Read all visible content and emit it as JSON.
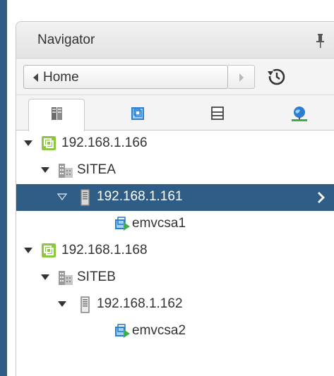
{
  "panel": {
    "title": "Navigator"
  },
  "nav": {
    "home_label": "Home"
  },
  "tabs": [
    {
      "name": "hosts-and-clusters",
      "icon": "hosts-clusters-icon",
      "active": true
    },
    {
      "name": "vms-and-templates",
      "icon": "vms-templates-icon",
      "active": false
    },
    {
      "name": "storage",
      "icon": "storage-icon",
      "active": false
    },
    {
      "name": "networking",
      "icon": "networking-icon",
      "active": false
    }
  ],
  "tree": {
    "vc1": {
      "label": "192.168.1.166"
    },
    "dc1": {
      "label": "SITEA"
    },
    "host1": {
      "label": "192.168.1.161"
    },
    "vm1": {
      "label": "emvcsa1"
    },
    "vc2": {
      "label": "192.168.1.168"
    },
    "dc2": {
      "label": "SITEB"
    },
    "host2": {
      "label": "192.168.1.162"
    },
    "vm2": {
      "label": "emvcsa2"
    }
  },
  "colors": {
    "selection": "#2f5d86",
    "vcenter_icon": "#8dc63f",
    "vm_icon": "#2a7ed3",
    "play_green": "#3cb043"
  }
}
